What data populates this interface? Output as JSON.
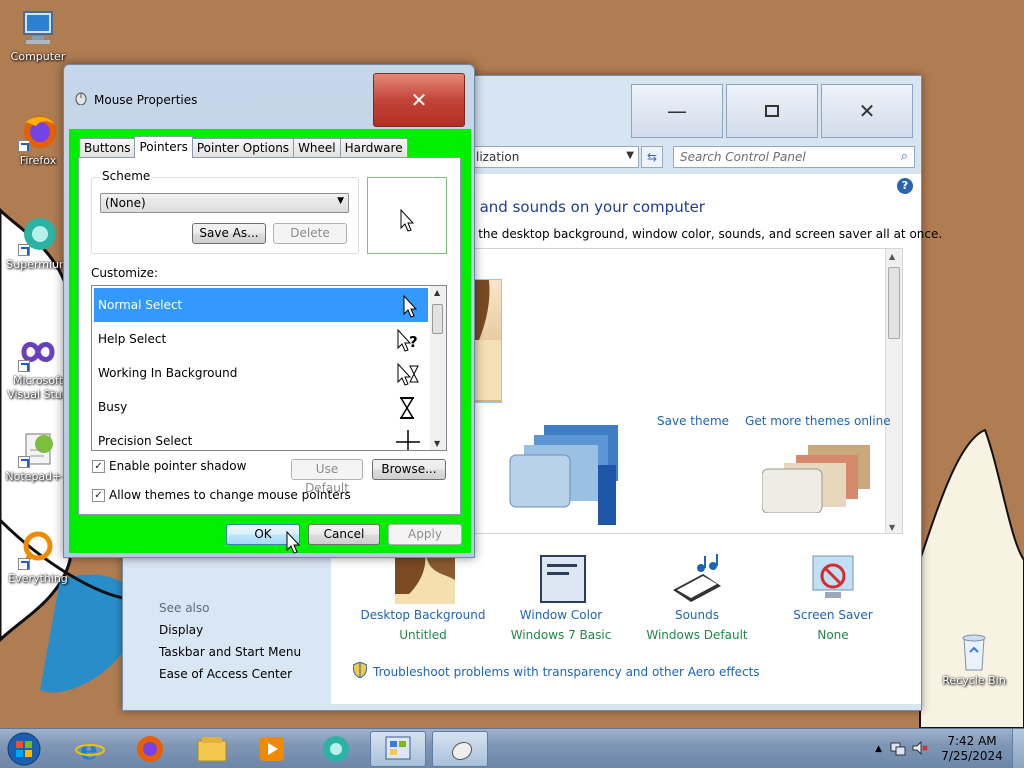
{
  "desktop": {
    "icons": [
      {
        "label": "Computer",
        "icon": "computer-icon"
      },
      {
        "label": "Firefox",
        "icon": "firefox-icon"
      },
      {
        "label": "Supermium",
        "icon": "supermium-icon"
      },
      {
        "label": "Microsoft\nVisual Stud",
        "icon": "visual-studio-icon"
      },
      {
        "label": "Notepad++",
        "icon": "notepad-plus-plus-icon"
      },
      {
        "label": "Everything",
        "icon": "everything-icon"
      },
      {
        "label": "Recycle Bin",
        "icon": "recycle-bin-icon"
      }
    ]
  },
  "control_panel": {
    "address_text": "lization",
    "search_placeholder": "Search Control Panel",
    "heading": "s and sounds on your computer",
    "description": "e the desktop background, window color, sounds, and screen saver all at once.",
    "save_theme": "Save theme",
    "more_themes": "Get more themes online",
    "items": [
      {
        "title": "Desktop Background",
        "value": "Untitled",
        "icon": "desktop-background-icon"
      },
      {
        "title": "Window Color",
        "value": "Windows 7 Basic",
        "icon": "window-color-icon"
      },
      {
        "title": "Sounds",
        "value": "Windows Default",
        "icon": "sounds-icon"
      },
      {
        "title": "Screen Saver",
        "value": "None",
        "icon": "screen-saver-icon"
      }
    ],
    "troubleshoot": "Troubleshoot problems with transparency and other Aero effects",
    "see_also": {
      "heading": "See also",
      "links": [
        "Display",
        "Taskbar and Start Menu",
        "Ease of Access Center"
      ]
    }
  },
  "mouse_properties": {
    "title": "Mouse Properties",
    "tabs": [
      "Buttons",
      "Pointers",
      "Pointer Options",
      "Wheel",
      "Hardware"
    ],
    "active_tab": "Pointers",
    "scheme_label": "Scheme",
    "scheme_value": "(None)",
    "save_as": "Save As...",
    "delete": "Delete",
    "customize_label": "Customize:",
    "pointers": [
      {
        "name": "Normal Select",
        "icon": "arrow-cursor-icon",
        "selected": true
      },
      {
        "name": "Help Select",
        "icon": "help-cursor-icon",
        "selected": false
      },
      {
        "name": "Working In Background",
        "icon": "working-cursor-icon",
        "selected": false
      },
      {
        "name": "Busy",
        "icon": "hourglass-cursor-icon",
        "selected": false
      },
      {
        "name": "Precision Select",
        "icon": "crosshair-cursor-icon",
        "selected": false
      }
    ],
    "enable_shadow": "Enable pointer shadow",
    "enable_shadow_checked": true,
    "allow_themes": "Allow themes to change mouse pointers",
    "allow_themes_checked": true,
    "use_default": "Use Default",
    "browse": "Browse...",
    "ok": "OK",
    "cancel": "Cancel",
    "apply": "Apply"
  },
  "taskbar": {
    "time": "7:42 AM",
    "date": "7/25/2024",
    "pinned": [
      "internet-explorer-icon",
      "firefox-icon",
      "file-explorer-icon",
      "media-player-icon",
      "supermium-icon",
      "control-panel-icon",
      "mouse-icon"
    ]
  },
  "colors": {
    "dialog_highlight": "#00ee00",
    "selection": "#3399ff",
    "link": "#1e64b4",
    "value_green": "#1e8a47"
  }
}
